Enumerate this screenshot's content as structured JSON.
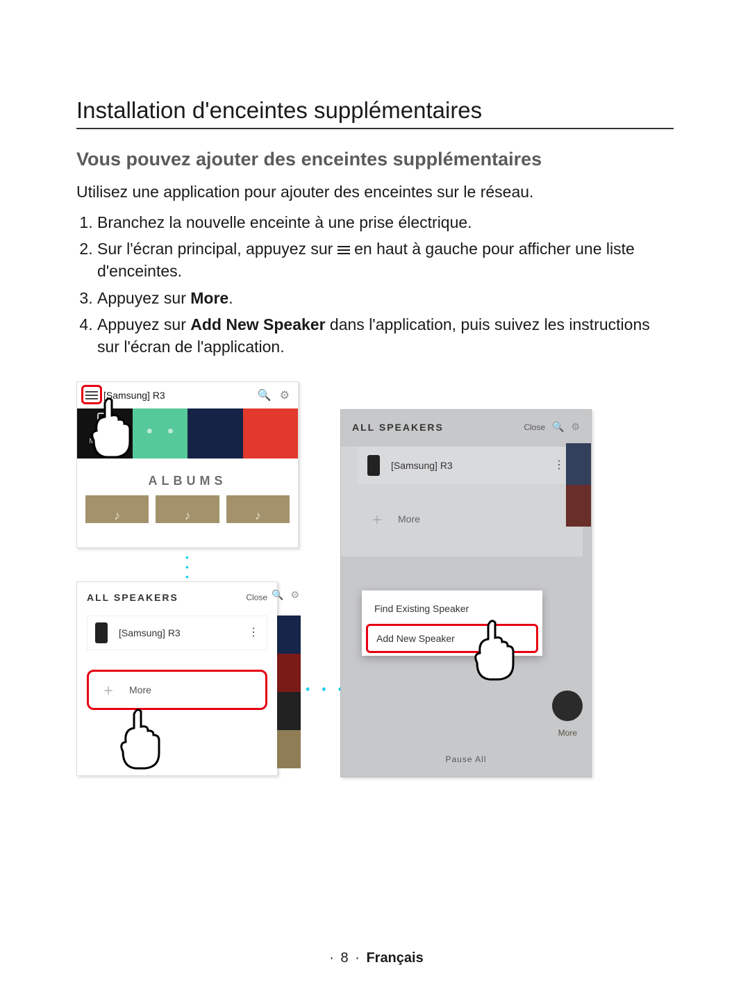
{
  "title": "Installation d'enceintes supplémentaires",
  "subtitle": "Vous pouvez ajouter des enceintes supplémentaires",
  "intro": "Utilisez une application pour ajouter des enceintes sur le réseau.",
  "steps": {
    "s1": "Branchez la nouvelle enceinte à une prise électrique.",
    "s2a": "Sur l'écran principal, appuyez sur ",
    "s2b": " en haut à gauche pour afficher une liste d'enceintes.",
    "s3a": "Appuyez sur ",
    "s3b": "More",
    "s3c": ".",
    "s4a": "Appuyez sur ",
    "s4b": "Add New Speaker",
    "s4c": " dans l'application, puis suivez les instructions sur l'écran de l'application."
  },
  "shot1": {
    "device": "[Samsung] R3",
    "myphone": "My Phone",
    "albums": "ALBUMS"
  },
  "shot2": {
    "header": "ALL SPEAKERS",
    "close": "Close",
    "device": "[Samsung] R3",
    "more": "More"
  },
  "shot3": {
    "header": "ALL SPEAKERS",
    "close": "Close",
    "device": "[Samsung] R3",
    "more": "More",
    "opt1": "Find Existing Speaker",
    "opt2": "Add New Speaker",
    "moreBtn": "More",
    "pause": "Pause All"
  },
  "footer": {
    "page": "8",
    "lang": "Français"
  }
}
